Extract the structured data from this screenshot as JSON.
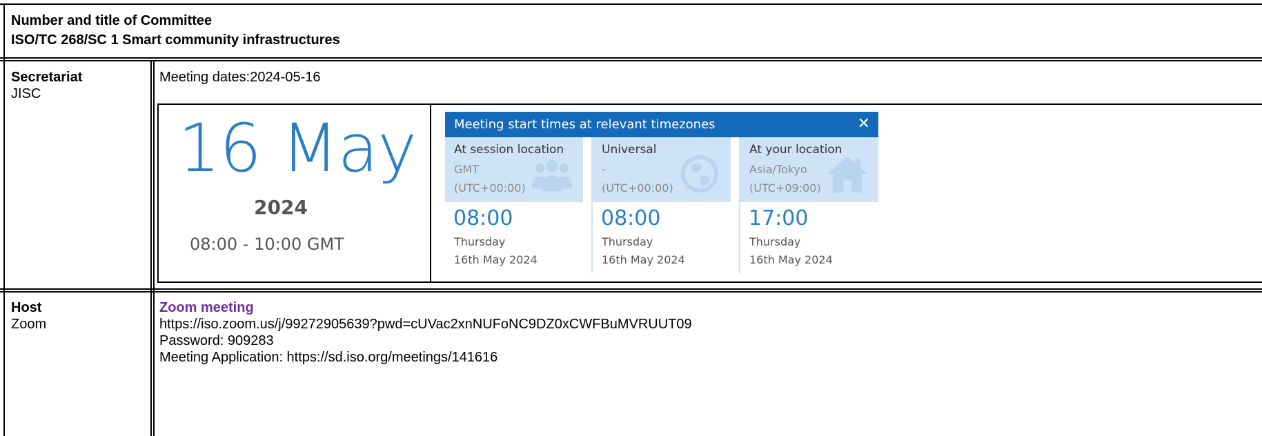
{
  "committee": {
    "heading": "Number and title of Committee",
    "title": "ISO/TC 268/SC 1 Smart community infrastructures"
  },
  "secretariat": {
    "label": "Secretariat",
    "value": "JISC"
  },
  "meeting": {
    "dates_text": "Meeting dates:2024-05-16",
    "big_date": "16 May",
    "year": "2024",
    "time_range": "08:00 - 10:00 GMT"
  },
  "timezones": {
    "title": "Meeting start times at relevant timezones",
    "close": "✕",
    "columns": [
      {
        "label": "At session location",
        "zone": "GMT",
        "offset": "(UTC+00:00)",
        "time": "08:00",
        "day": "Thursday",
        "date": "16th May 2024",
        "icon": "people-icon"
      },
      {
        "label": "Universal",
        "zone": "-",
        "offset": "(UTC+00:00)",
        "time": "08:00",
        "day": "Thursday",
        "date": "16th May 2024",
        "icon": "globe-icon"
      },
      {
        "label": "At your location",
        "zone": "Asia/Tokyo",
        "offset": "(UTC+09:00)",
        "time": "17:00",
        "day": "Thursday",
        "date": "16th May 2024",
        "icon": "house-icon"
      }
    ],
    "colors": {
      "header": "#1469b8",
      "panel": "#cfe3f6",
      "accent": "#2a7fc4"
    }
  },
  "host": {
    "label": "Host",
    "value": "Zoom",
    "link_text": "Zoom meeting",
    "url": "https://iso.zoom.us/j/99272905639?pwd=cUVac2xnNUFoNC9DZ0xCWFBuMVRUUT09",
    "password": "Password: 909283",
    "application": "Meeting Application: https://sd.iso.org/meetings/141616"
  }
}
